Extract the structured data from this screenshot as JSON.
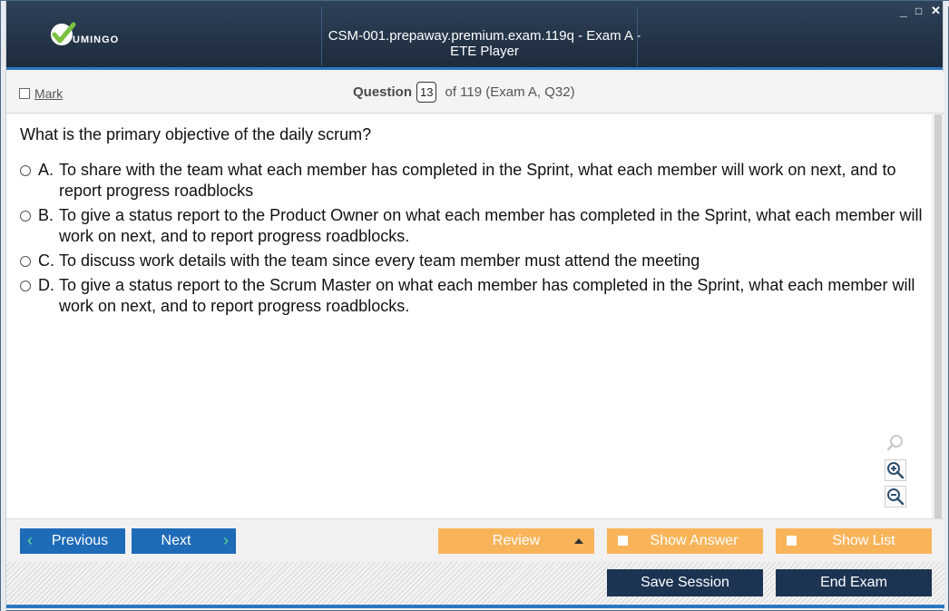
{
  "app": {
    "logo_text": "UMINGO",
    "title": "CSM-001.prepaway.premium.exam.119q - Exam A - ETE Player",
    "controls": {
      "minimize": "_",
      "maximize": "□",
      "close": "✕"
    }
  },
  "header": {
    "mark_label": "Mark",
    "question_label": "Question",
    "question_number": "13",
    "question_of": "of 119 (Exam A, Q32)"
  },
  "question": {
    "text": "What is the primary objective of the daily scrum?",
    "answers": [
      {
        "letter": "A.",
        "text": "To share with the team what each member has completed in the Sprint, what each member will work on next, and to report progress roadblocks"
      },
      {
        "letter": "B.",
        "text": "To give a status report to the Product Owner on what each member has completed in the Sprint, what each member will work on next, and to report progress roadblocks."
      },
      {
        "letter": "C.",
        "text": "To discuss work details with the team since every team member must attend the meeting"
      },
      {
        "letter": "D.",
        "text": "To give a status report to the Scrum Master on what each member has completed in the Sprint, what each member will work on next, and to report progress roadblocks."
      }
    ]
  },
  "nav": {
    "previous": "Previous",
    "next": "Next",
    "review": "Review",
    "show_answer": "Show Answer",
    "show_list": "Show List"
  },
  "bottom": {
    "save_session": "Save Session",
    "end_exam": "End Exam"
  },
  "icons": {
    "logo": "check-logo-icon",
    "zoom_reset": "magnifier-icon",
    "zoom_in": "zoom-in-icon",
    "zoom_out": "zoom-out-icon"
  },
  "colors": {
    "titlebar": "#1d2b3c",
    "accent_blue": "#1e6bb8",
    "orange": "#f9b45a",
    "dark_button": "#1d3352",
    "logo_green": "#7ac142"
  }
}
